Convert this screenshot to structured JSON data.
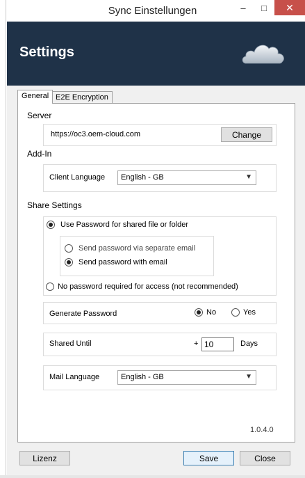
{
  "window": {
    "title": "Sync Einstellungen",
    "minimize_glyph": "–",
    "maximize_glyph": "□",
    "close_glyph": "✕"
  },
  "banner": {
    "title": "Settings",
    "icon": "cloud-icon",
    "background": "#1f3248"
  },
  "tabs": [
    {
      "label": "General",
      "active": true
    },
    {
      "label": "E2E Encryption",
      "active": false
    }
  ],
  "server": {
    "section_label": "Server",
    "url": "https://oc3.oem-cloud.com",
    "change_label": "Change"
  },
  "addin": {
    "section_label": "Add-In",
    "client_language_label": "Client Language",
    "client_language_value": "English - GB"
  },
  "share": {
    "section_label": "Share Settings",
    "use_password_label": "Use Password for shared file or folder",
    "use_password_selected": true,
    "send_separate_label": "Send password via separate email",
    "send_separate_selected": false,
    "send_with_label": "Send password with email",
    "send_with_selected": true,
    "no_password_label": "No password required for access (not recommended)",
    "no_password_selected": false,
    "generate_password_label": "Generate Password",
    "generate_no_label": "No",
    "generate_yes_label": "Yes",
    "generate_value": "No",
    "shared_until_label": "Shared Until",
    "shared_until_prefix": "+",
    "shared_until_value": "10",
    "shared_until_unit": "Days",
    "mail_language_label": "Mail Language",
    "mail_language_value": "English - GB"
  },
  "version": "1.0.4.0",
  "footer": {
    "license_label": "Lizenz",
    "save_label": "Save",
    "close_label": "Close"
  }
}
